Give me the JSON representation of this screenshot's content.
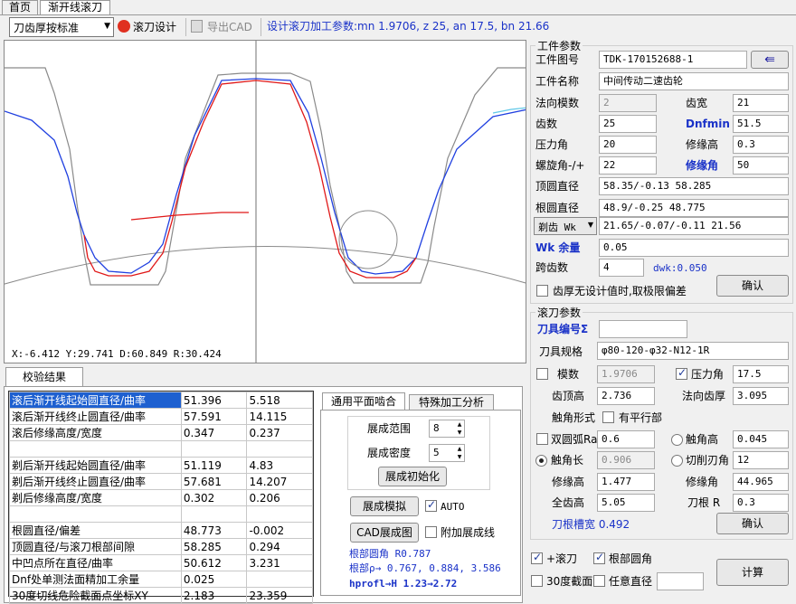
{
  "tabs": [
    "首页",
    "渐开线滚刀"
  ],
  "toolbar": {
    "combo_value": "刀齿厚按标准",
    "hob_design": "滚刀设计",
    "export_cad": "导出CAD",
    "status": "设计滚刀加工参数:mn 1.9706, z 25, an 17.5, bn 21.66"
  },
  "plot": {
    "readout": "X:-6.412   Y:29.741   D:60.849   R:30.424",
    "colors": {
      "red": "#e01818",
      "blue": "#2040e0",
      "gray": "#8a8a8a",
      "cyan": "#60c8e8"
    }
  },
  "results": {
    "tab": "校验结果",
    "rows": [
      [
        "滚后渐开线起始圆直径/曲率",
        "51.396",
        "5.518"
      ],
      [
        "滚后渐开线终止圆直径/曲率",
        "57.591",
        "14.115"
      ],
      [
        "滚后修缘高度/宽度",
        "0.347",
        "0.237"
      ],
      [
        "",
        "",
        ""
      ],
      [
        "剃后渐开线起始圆直径/曲率",
        "51.119",
        "4.83"
      ],
      [
        "剃后渐开线终止圆直径/曲率",
        "57.681",
        "14.207"
      ],
      [
        "剃后修缘高度/宽度",
        "0.302",
        "0.206"
      ],
      [
        "",
        "",
        ""
      ],
      [
        "根圆直径/偏差",
        "48.773",
        "-0.002"
      ],
      [
        "顶圆直径/与滚刀根部间隙",
        "58.285",
        "0.294"
      ],
      [
        "中凹点所在直径/曲率",
        "50.612",
        "3.231"
      ],
      [
        "Dnf处单测法面精加工余量",
        "0.025",
        ""
      ],
      [
        "30度切线危险截面点坐标XY",
        "2.183",
        "23.359"
      ]
    ]
  },
  "mesh": {
    "tab1": "通用平面啮合",
    "tab2": "特殊加工分析",
    "range_label": "展成范围",
    "range_value": "8",
    "density_label": "展成密度",
    "density_value": "5",
    "init_btn": "展成初始化",
    "simulate_btn": "展成模拟",
    "auto_label": "AUTO",
    "cad_btn": "CAD展成图",
    "extra_label": "附加展成线",
    "root_arc": "根部圆角  R0.787",
    "root_rho": "根部ρ→  0.767, 0.884, 3.586",
    "hprofl": "hprofl→H  1.23→2.72"
  },
  "workpiece": {
    "title": "工件参数",
    "drawing_no_label": "工件图号",
    "drawing_no": "TDK-170152688-1",
    "name_label": "工件名称",
    "name": "中间传动二速齿轮",
    "module_label": "法向模数",
    "module": "2",
    "face_width_label": "齿宽",
    "face_width": "21",
    "teeth_label": "齿数",
    "teeth": "25",
    "dnfmin_label": "Dnfmin",
    "dnfmin": "51.5",
    "pressure_label": "压力角",
    "pressure": "20",
    "tip_relief_h_label": "修缘高",
    "tip_relief_h": "0.3",
    "helix_label": "螺旋角-/+",
    "helix": "22",
    "tip_relief_a_label": "修缘角",
    "tip_relief_a": "50",
    "tip_dia_label": "顶圆直径",
    "tip_dia": "58.35/-0.13  58.285",
    "root_dia_label": "根圆直径",
    "root_dia": "48.9/-0.25  48.775",
    "shave_combo": "剃齿 Wk",
    "wk": "21.65/-0.07/-0.11  21.56",
    "wk_allow_label": "Wk 余量",
    "wk_allow": "0.05",
    "span_label": "跨齿数",
    "span": "4",
    "dwk": "dwk:0.050",
    "limit_label": "齿厚无设计值时,取极限偏差",
    "confirm": "确认"
  },
  "hob": {
    "title": "滚刀参数",
    "tool_no_label": "刀具编号Σ",
    "tool_no": "",
    "spec_label": "刀具规格",
    "spec": "φ80-120-φ32-N12-1R",
    "module_label": "模数",
    "module": "1.9706",
    "pressure_label": "压力角",
    "pressure": "17.5",
    "addendum_label": "齿顶高",
    "addendum": "2.736",
    "thickness_label": "法向齿厚",
    "thickness": "3.095",
    "tip_form_label": "触角形式",
    "parallel_label": "有平行部",
    "double_arc_label": "双圆弧Ra",
    "double_arc": "0.6",
    "tip_h_label": "触角高",
    "tip_h": "0.045",
    "tip_len_label": "触角长",
    "tip_len": "0.906",
    "cut_edge_label": "切削刃角",
    "cut_edge": "12",
    "edge_h_label": "修缘高",
    "edge_h": "1.477",
    "edge_a_label": "修缘角",
    "edge_a": "44.965",
    "full_h_label": "全齿高",
    "full_h": "5.05",
    "r_label": "刀根 R",
    "r": "0.3",
    "groove": "刀根槽宽  0.492",
    "confirm": "确认"
  },
  "bottom": {
    "plus_hob": "+滚刀",
    "root_fillet": "根部圆角",
    "section30": "30度截面",
    "any_dia": "任意直径",
    "calc": "计算"
  }
}
